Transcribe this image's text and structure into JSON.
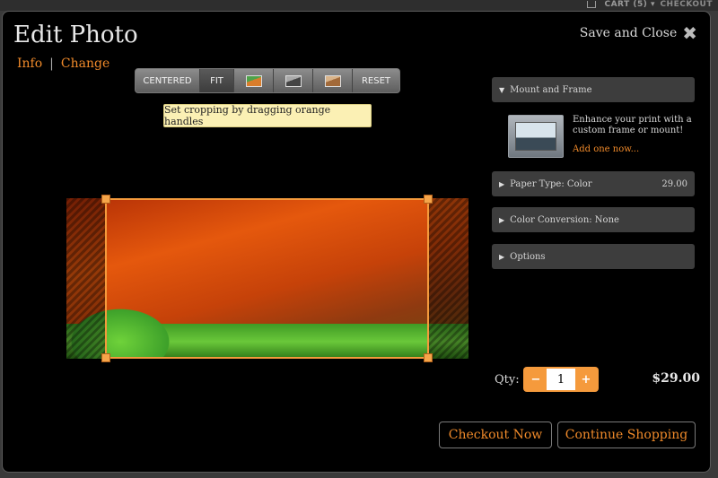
{
  "topbar": {
    "cart": "CART (5) ▾",
    "checkout": "CHECKOUT"
  },
  "header": {
    "title": "Edit Photo",
    "save_close": "Save and Close",
    "close_glyph": "✖"
  },
  "subnav": {
    "info": "Info",
    "separator": "|",
    "change": "Change"
  },
  "toolbar": {
    "centered": "CENTERED",
    "fit": "FIT",
    "reset": "RESET",
    "icons": [
      "color-thumb-icon",
      "grayscale-thumb-icon",
      "sepia-thumb-icon"
    ]
  },
  "hint": "Set cropping by dragging orange handles",
  "panels": {
    "mount_frame": "Mount and Frame",
    "mount_text": "Enhance your print with a custom frame or mount!",
    "mount_link": "Add one now...",
    "paper_type": "Paper Type: Color",
    "paper_price": "29.00",
    "color_conversion": "Color Conversion: None",
    "options": "Options"
  },
  "triangles": {
    "open": "▼",
    "closed": "▶"
  },
  "qty": {
    "label": "Qty:",
    "value": "1",
    "minus": "−",
    "plus": "+"
  },
  "total": "$29.00",
  "buttons": {
    "checkout_now": "Checkout Now",
    "continue_shopping": "Continue Shopping"
  },
  "colors": {
    "accent": "#f08a2a",
    "panel": "#3d3d3d",
    "hint_bg": "#fbf0b4"
  }
}
